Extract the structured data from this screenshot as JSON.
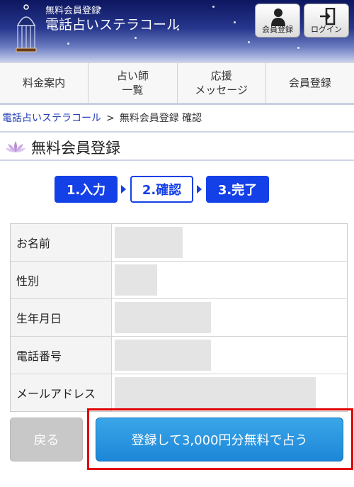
{
  "header": {
    "subtitle": "無料会員登録",
    "title": "電話占いステラコール",
    "buttons": [
      {
        "label": "会員登録",
        "icon": "person-icon"
      },
      {
        "label": "ログイン",
        "icon": "login-icon"
      }
    ]
  },
  "nav": {
    "items": [
      {
        "label": "料金案内"
      },
      {
        "label": "占い師\n一覧"
      },
      {
        "label": "応援\nメッセージ"
      },
      {
        "label": "会員登録"
      }
    ]
  },
  "breadcrumb": {
    "home": "電話占いステラコール",
    "separator": ">",
    "current": "無料会員登録 確認"
  },
  "section": {
    "title": "無料会員登録",
    "icon": "lotus-icon"
  },
  "steps": [
    {
      "label": "1.入力",
      "state": "filled"
    },
    {
      "label": "2.確認",
      "state": "current"
    },
    {
      "label": "3.完了",
      "state": "filled"
    }
  ],
  "form": {
    "rows": [
      {
        "label": "お名前"
      },
      {
        "label": "性別"
      },
      {
        "label": "生年月日"
      },
      {
        "label": "電話番号"
      },
      {
        "label": "メールアドレス"
      }
    ]
  },
  "actions": {
    "back_label": "戻る",
    "submit_label": "登録して3,000円分無料で占う"
  },
  "colors": {
    "step_blue": "#1440e8",
    "submit_blue": "#2a96e0",
    "highlight_red": "#e00000",
    "back_gray": "#c8c8c8"
  }
}
